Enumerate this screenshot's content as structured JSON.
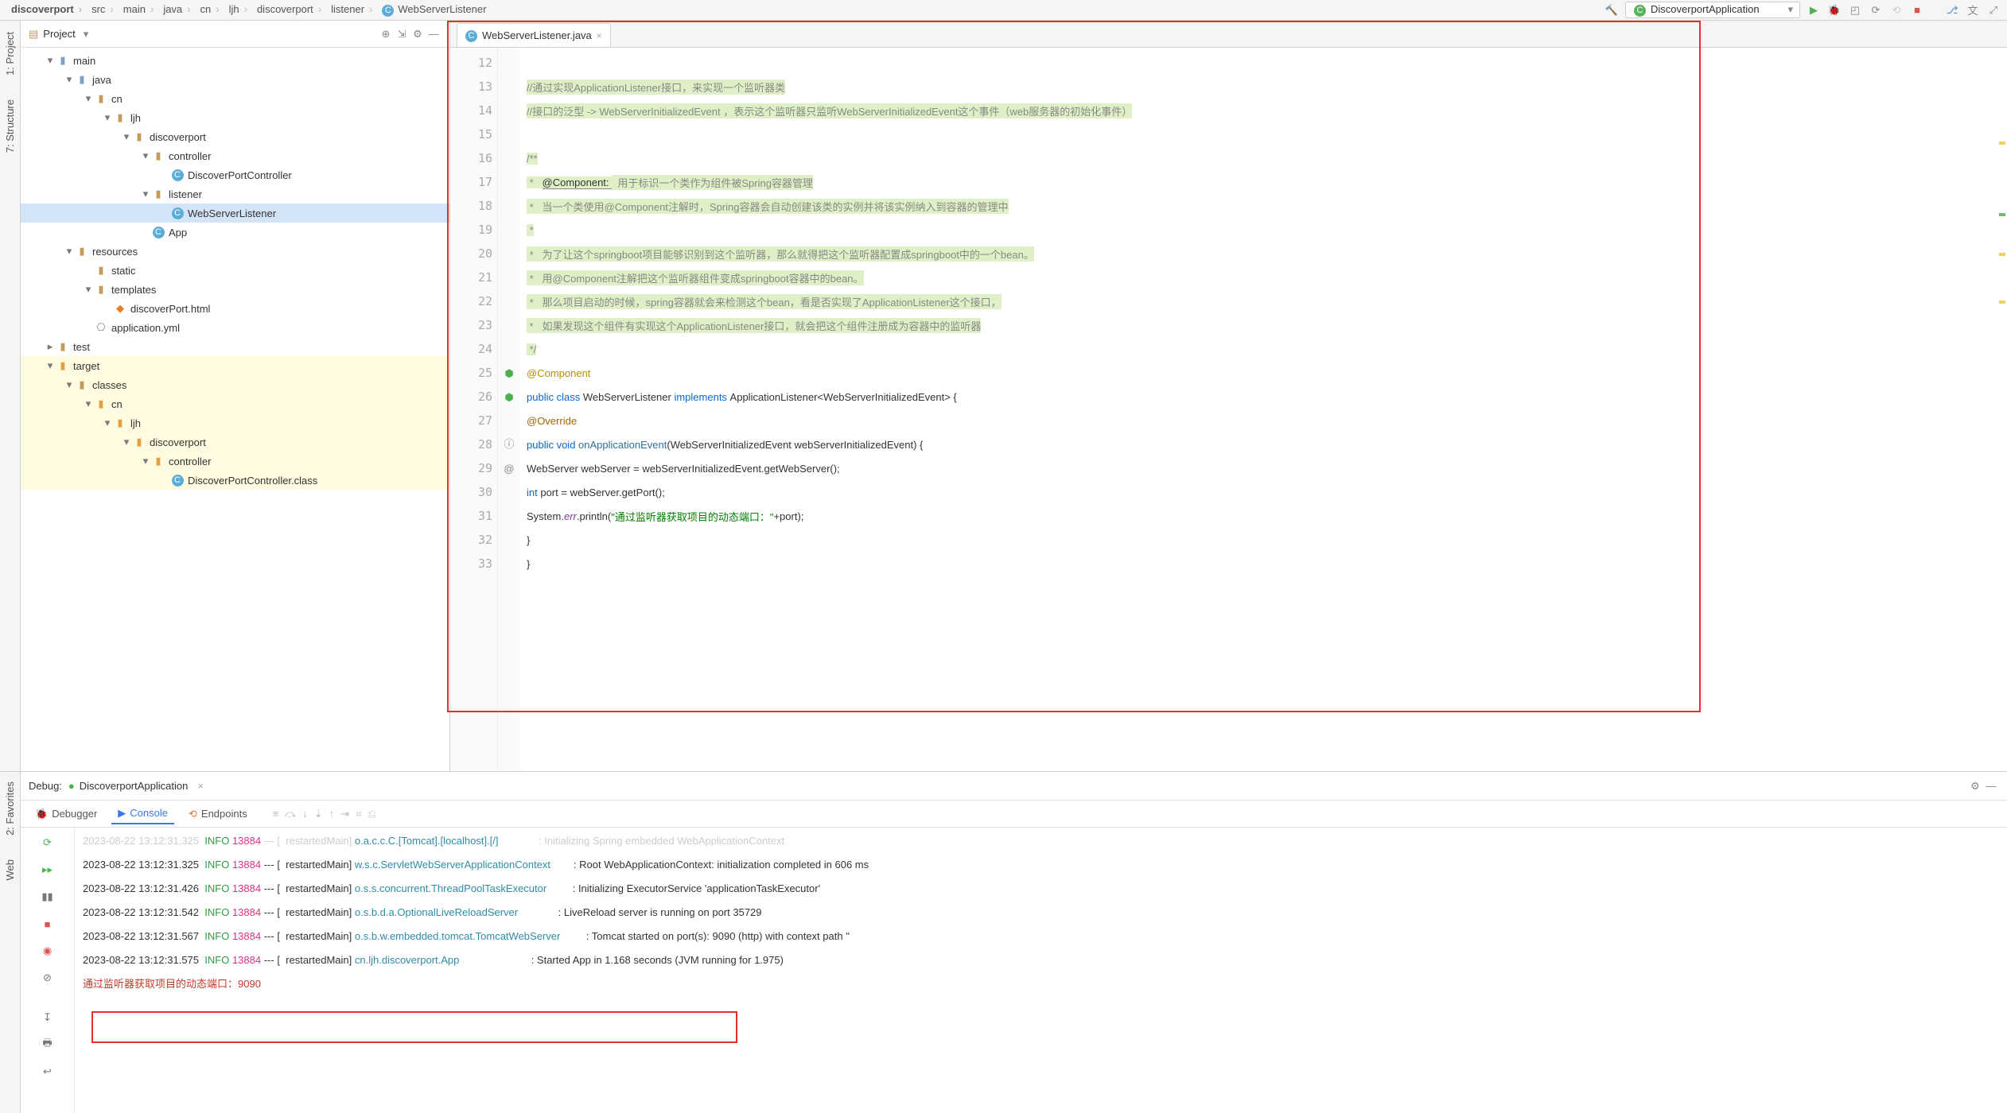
{
  "breadcrumb": [
    "discoverport",
    "src",
    "main",
    "java",
    "cn",
    "ljh",
    "discoverport",
    "listener",
    "WebServerListener"
  ],
  "run_config": "DiscoverportApplication",
  "left_tabs": [
    "1: Project",
    "7: Structure"
  ],
  "bottom_left_tabs": [
    "2: Favorites",
    "Web"
  ],
  "project": {
    "title": "Project",
    "tree": [
      {
        "d": 0,
        "arrow": "▾",
        "ico": "fld-src",
        "label": "main"
      },
      {
        "d": 1,
        "arrow": "▾",
        "ico": "fld-src",
        "label": "java"
      },
      {
        "d": 2,
        "arrow": "▾",
        "ico": "fld",
        "label": "cn"
      },
      {
        "d": 3,
        "arrow": "▾",
        "ico": "fld",
        "label": "ljh"
      },
      {
        "d": 4,
        "arrow": "▾",
        "ico": "fld",
        "label": "discoverport"
      },
      {
        "d": 5,
        "arrow": "▾",
        "ico": "fld",
        "label": "controller"
      },
      {
        "d": 6,
        "arrow": "",
        "ico": "cl",
        "label": "DiscoverPortController"
      },
      {
        "d": 5,
        "arrow": "▾",
        "ico": "fld",
        "label": "listener"
      },
      {
        "d": 6,
        "arrow": "",
        "ico": "cl",
        "label": "WebServerListener",
        "sel": true
      },
      {
        "d": 5,
        "arrow": "",
        "ico": "cl",
        "label": "App"
      },
      {
        "d": 1,
        "arrow": "▾",
        "ico": "fld",
        "label": "resources"
      },
      {
        "d": 2,
        "arrow": "",
        "ico": "fld",
        "label": "static"
      },
      {
        "d": 2,
        "arrow": "▾",
        "ico": "fld",
        "label": "templates"
      },
      {
        "d": 3,
        "arrow": "",
        "ico": "html",
        "label": "discoverPort.html"
      },
      {
        "d": 2,
        "arrow": "",
        "ico": "yml",
        "label": "application.yml"
      },
      {
        "d": 0,
        "arrow": "▸",
        "ico": "fld",
        "label": "test"
      },
      {
        "d": 0,
        "arrow": "▾",
        "ico": "fld-o",
        "label": "target",
        "hl": true
      },
      {
        "d": 1,
        "arrow": "▾",
        "ico": "fld",
        "label": "classes",
        "hl": true
      },
      {
        "d": 2,
        "arrow": "▾",
        "ico": "fld-o",
        "label": "cn",
        "hl": true
      },
      {
        "d": 3,
        "arrow": "▾",
        "ico": "fld-o",
        "label": "ljh",
        "hl": true
      },
      {
        "d": 4,
        "arrow": "▾",
        "ico": "fld-o",
        "label": "discoverport",
        "hl": true
      },
      {
        "d": 5,
        "arrow": "▾",
        "ico": "fld-o",
        "label": "controller",
        "hl": true
      },
      {
        "d": 6,
        "arrow": "",
        "ico": "cl",
        "label": "DiscoverPortController.class",
        "hl": true
      }
    ]
  },
  "editor": {
    "tab": "WebServerListener.java",
    "lines": [
      {
        "n": 12,
        "html": ""
      },
      {
        "n": 13,
        "html": "<span class='cmt cmt-bg'>//通过实现ApplicationListener接口，来实现一个监听器类</span>"
      },
      {
        "n": 14,
        "html": "<span class='cmt cmt-bg'>//接口的泛型 -&gt; WebServerInitializedEvent ，表示这个监听器只监听WebServerInitializedEvent这个事件（web服务器的初始化事件）</span>"
      },
      {
        "n": 15,
        "html": ""
      },
      {
        "n": 16,
        "html": "<span class='cmt cmt-bg'>/**</span>"
      },
      {
        "n": 17,
        "html": "<span class='cmt cmt-bg'> *   </span><span class='cmt-bg'><span style='border-bottom:1px solid #888'>@Component: </span></span><span class='cmt cmt-bg'>  用于标识一个类作为组件被Spring容器管理</span>"
      },
      {
        "n": 18,
        "html": "<span class='cmt cmt-bg'> *   当一个类使用@Component注解时，Spring容器会自动创建该类的实例并将该实例纳入到容器的管理中</span>"
      },
      {
        "n": 19,
        "html": "<span class='cmt cmt-bg'> *</span>"
      },
      {
        "n": 20,
        "html": "<span class='cmt cmt-bg'> *   为了让这个springboot项目能够识别到这个监听器，那么就得把这个监听器配置成springboot中的一个bean。</span>"
      },
      {
        "n": 21,
        "html": "<span class='cmt cmt-bg'> *   用@Component注解把这个监听器组件变成springboot容器中的bean。</span>"
      },
      {
        "n": 22,
        "html": "<span class='cmt cmt-bg'> *   那么项目启动的时候，spring容器就会来检测这个bean，看是否实现了ApplicationListener这个接口，</span>"
      },
      {
        "n": 23,
        "html": "<span class='cmt cmt-bg'> *   如果发现这个组件有实现这个ApplicationListener接口，就会把这个组件注册成为容器中的监听器</span>"
      },
      {
        "n": 24,
        "html": "<span class='cmt cmt-bg'> */</span>"
      },
      {
        "n": 25,
        "html": "<span class='ann'>@Component</span>"
      },
      {
        "n": 26,
        "html": "<span class='key'>public class </span><span class='ident'>WebServerListener </span><span class='key'>implements </span><span class='ident'>ApplicationListener&lt;WebServerInitializedEvent&gt; {</span>"
      },
      {
        "n": 27,
        "html": "    <span class='over'>@Override</span>"
      },
      {
        "n": 28,
        "html": "    <span class='key'>public void </span><span class='ident' style='color:#2f6f9f'>onApplicationEvent</span><span class='ident'>(WebServerInitializedEvent webServerInitializedEvent) {</span>"
      },
      {
        "n": 29,
        "html": "        <span class='ident'>WebServer webServer = webServerInitializedEvent.getWebServer();</span>"
      },
      {
        "n": 30,
        "html": "        <span class='key'>int </span><span class='ident'>port = webServer.getPort();</span>"
      },
      {
        "n": 31,
        "html": "        <span class='ident'>System.</span><span class='field-italic'>err</span><span class='ident'>.println(</span><span class='str'>\"通过监听器获取项目的动态端口：\"</span><span class='ident'>+port);</span>"
      },
      {
        "n": 32,
        "html": "    <span class='ident'>}</span>"
      },
      {
        "n": 33,
        "html": "<span class='ident'>}</span>"
      }
    ]
  },
  "debug": {
    "title": "Debug:",
    "app_tab": "DiscoverportApplication",
    "tabs": {
      "debugger": "Debugger",
      "console": "Console",
      "endpoints": "Endpoints"
    },
    "log": [
      {
        "ts": "2023-08-22 13:12:31.325",
        "lvl": "INFO",
        "pid": "13884",
        "thr": "restartedMain",
        "logger": "o.a.c.c.C.[Tomcat].[localhost].[/]",
        "msg": "Initializing Spring embedded WebApplicationContext",
        "dim": true
      },
      {
        "ts": "2023-08-22 13:12:31.325",
        "lvl": "INFO",
        "pid": "13884",
        "thr": "restartedMain",
        "logger": "w.s.c.ServletWebServerApplicationContext",
        "msg": "Root WebApplicationContext: initialization completed in 606 ms"
      },
      {
        "ts": "2023-08-22 13:12:31.426",
        "lvl": "INFO",
        "pid": "13884",
        "thr": "restartedMain",
        "logger": "o.s.s.concurrent.ThreadPoolTaskExecutor",
        "msg": "Initializing ExecutorService 'applicationTaskExecutor'"
      },
      {
        "ts": "2023-08-22 13:12:31.542",
        "lvl": "INFO",
        "pid": "13884",
        "thr": "restartedMain",
        "logger": "o.s.b.d.a.OptionalLiveReloadServer",
        "msg": "LiveReload server is running on port 35729"
      },
      {
        "ts": "2023-08-22 13:12:31.567",
        "lvl": "INFO",
        "pid": "13884",
        "thr": "restartedMain",
        "logger": "o.s.b.w.embedded.tomcat.TomcatWebServer",
        "msg": "Tomcat started on port(s): 9090 (http) with context path ''"
      },
      {
        "ts": "2023-08-22 13:12:31.575",
        "lvl": "INFO",
        "pid": "13884",
        "thr": "restartedMain",
        "logger": "cn.ljh.discoverport.App",
        "msg": "Started App in 1.168 seconds (JVM running for 1.975)"
      }
    ],
    "stdout_line": "通过监听器获取项目的动态端口：9090"
  }
}
